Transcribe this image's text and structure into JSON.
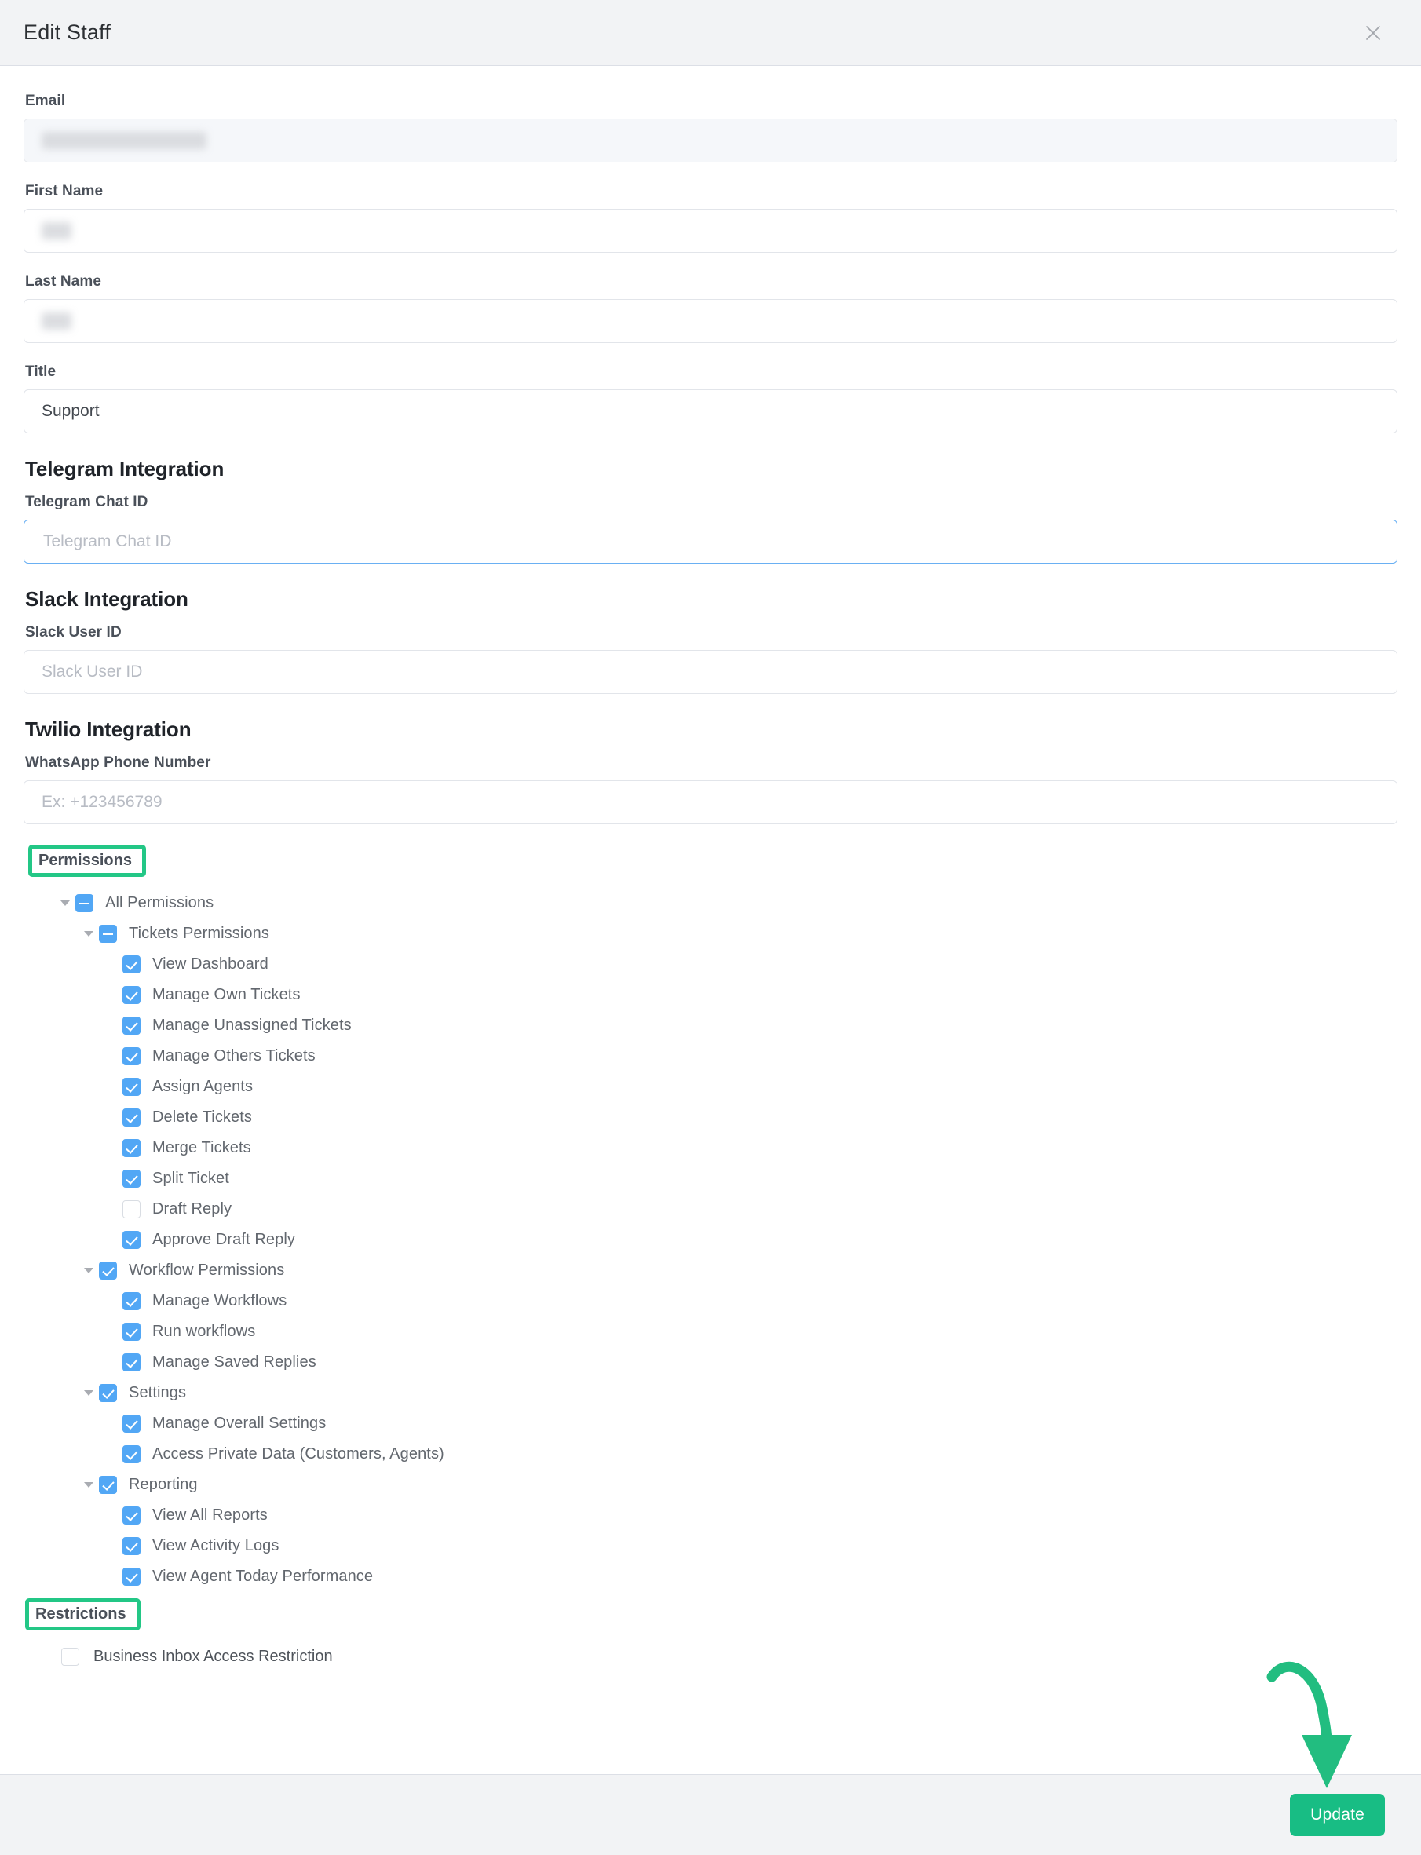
{
  "modal": {
    "title": "Edit Staff",
    "close_icon": "close-icon"
  },
  "form": {
    "email": {
      "label": "Email",
      "value": "",
      "redacted": true,
      "disabled": true
    },
    "first_name": {
      "label": "First Name",
      "value": "",
      "redacted": true
    },
    "last_name": {
      "label": "Last Name",
      "value": "",
      "redacted": true
    },
    "title": {
      "label": "Title",
      "value": "Support"
    }
  },
  "telegram": {
    "section_title": "Telegram Integration",
    "chat_id": {
      "label": "Telegram Chat ID",
      "placeholder": "Telegram Chat ID",
      "value": "",
      "focused": true
    }
  },
  "slack": {
    "section_title": "Slack Integration",
    "user_id": {
      "label": "Slack User ID",
      "placeholder": "Slack User ID",
      "value": ""
    }
  },
  "twilio": {
    "section_title": "Twilio Integration",
    "whatsapp": {
      "label": "WhatsApp Phone Number",
      "placeholder": "Ex: +123456789",
      "value": ""
    }
  },
  "permissions": {
    "heading": "Permissions",
    "heading_highlighted": true,
    "tree": [
      {
        "label": "All Permissions",
        "depth": 0,
        "state": "indeterminate",
        "expandable": true
      },
      {
        "label": "Tickets Permissions",
        "depth": 1,
        "state": "indeterminate",
        "expandable": true
      },
      {
        "label": "View Dashboard",
        "depth": 2,
        "state": "checked",
        "expandable": false
      },
      {
        "label": "Manage Own Tickets",
        "depth": 2,
        "state": "checked",
        "expandable": false
      },
      {
        "label": "Manage Unassigned Tickets",
        "depth": 2,
        "state": "checked",
        "expandable": false
      },
      {
        "label": "Manage Others Tickets",
        "depth": 2,
        "state": "checked",
        "expandable": false
      },
      {
        "label": "Assign Agents",
        "depth": 2,
        "state": "checked",
        "expandable": false
      },
      {
        "label": "Delete Tickets",
        "depth": 2,
        "state": "checked",
        "expandable": false
      },
      {
        "label": "Merge Tickets",
        "depth": 2,
        "state": "checked",
        "expandable": false
      },
      {
        "label": "Split Ticket",
        "depth": 2,
        "state": "checked",
        "expandable": false
      },
      {
        "label": "Draft Reply",
        "depth": 2,
        "state": "unchecked",
        "expandable": false
      },
      {
        "label": "Approve Draft Reply",
        "depth": 2,
        "state": "checked",
        "expandable": false
      },
      {
        "label": "Workflow Permissions",
        "depth": 1,
        "state": "checked",
        "expandable": true
      },
      {
        "label": "Manage Workflows",
        "depth": 2,
        "state": "checked",
        "expandable": false
      },
      {
        "label": "Run workflows",
        "depth": 2,
        "state": "checked",
        "expandable": false
      },
      {
        "label": "Manage Saved Replies",
        "depth": 2,
        "state": "checked",
        "expandable": false
      },
      {
        "label": "Settings",
        "depth": 1,
        "state": "checked",
        "expandable": true
      },
      {
        "label": "Manage Overall Settings",
        "depth": 2,
        "state": "checked",
        "expandable": false
      },
      {
        "label": "Access Private Data (Customers, Agents)",
        "depth": 2,
        "state": "checked",
        "expandable": false
      },
      {
        "label": "Reporting",
        "depth": 1,
        "state": "checked",
        "expandable": true
      },
      {
        "label": "View All Reports",
        "depth": 2,
        "state": "checked",
        "expandable": false
      },
      {
        "label": "View Activity Logs",
        "depth": 2,
        "state": "checked",
        "expandable": false
      },
      {
        "label": "View Agent Today Performance",
        "depth": 2,
        "state": "checked",
        "expandable": false
      }
    ]
  },
  "restrictions": {
    "heading": "Restrictions",
    "heading_highlighted": true,
    "items": [
      {
        "label": "Business Inbox Access Restriction",
        "state": "unchecked"
      }
    ]
  },
  "footer": {
    "update_label": "Update"
  },
  "annotations": {
    "highlight_color": "#23c786",
    "arrow_color": "#22bd80",
    "arrow_target": "update-button"
  }
}
